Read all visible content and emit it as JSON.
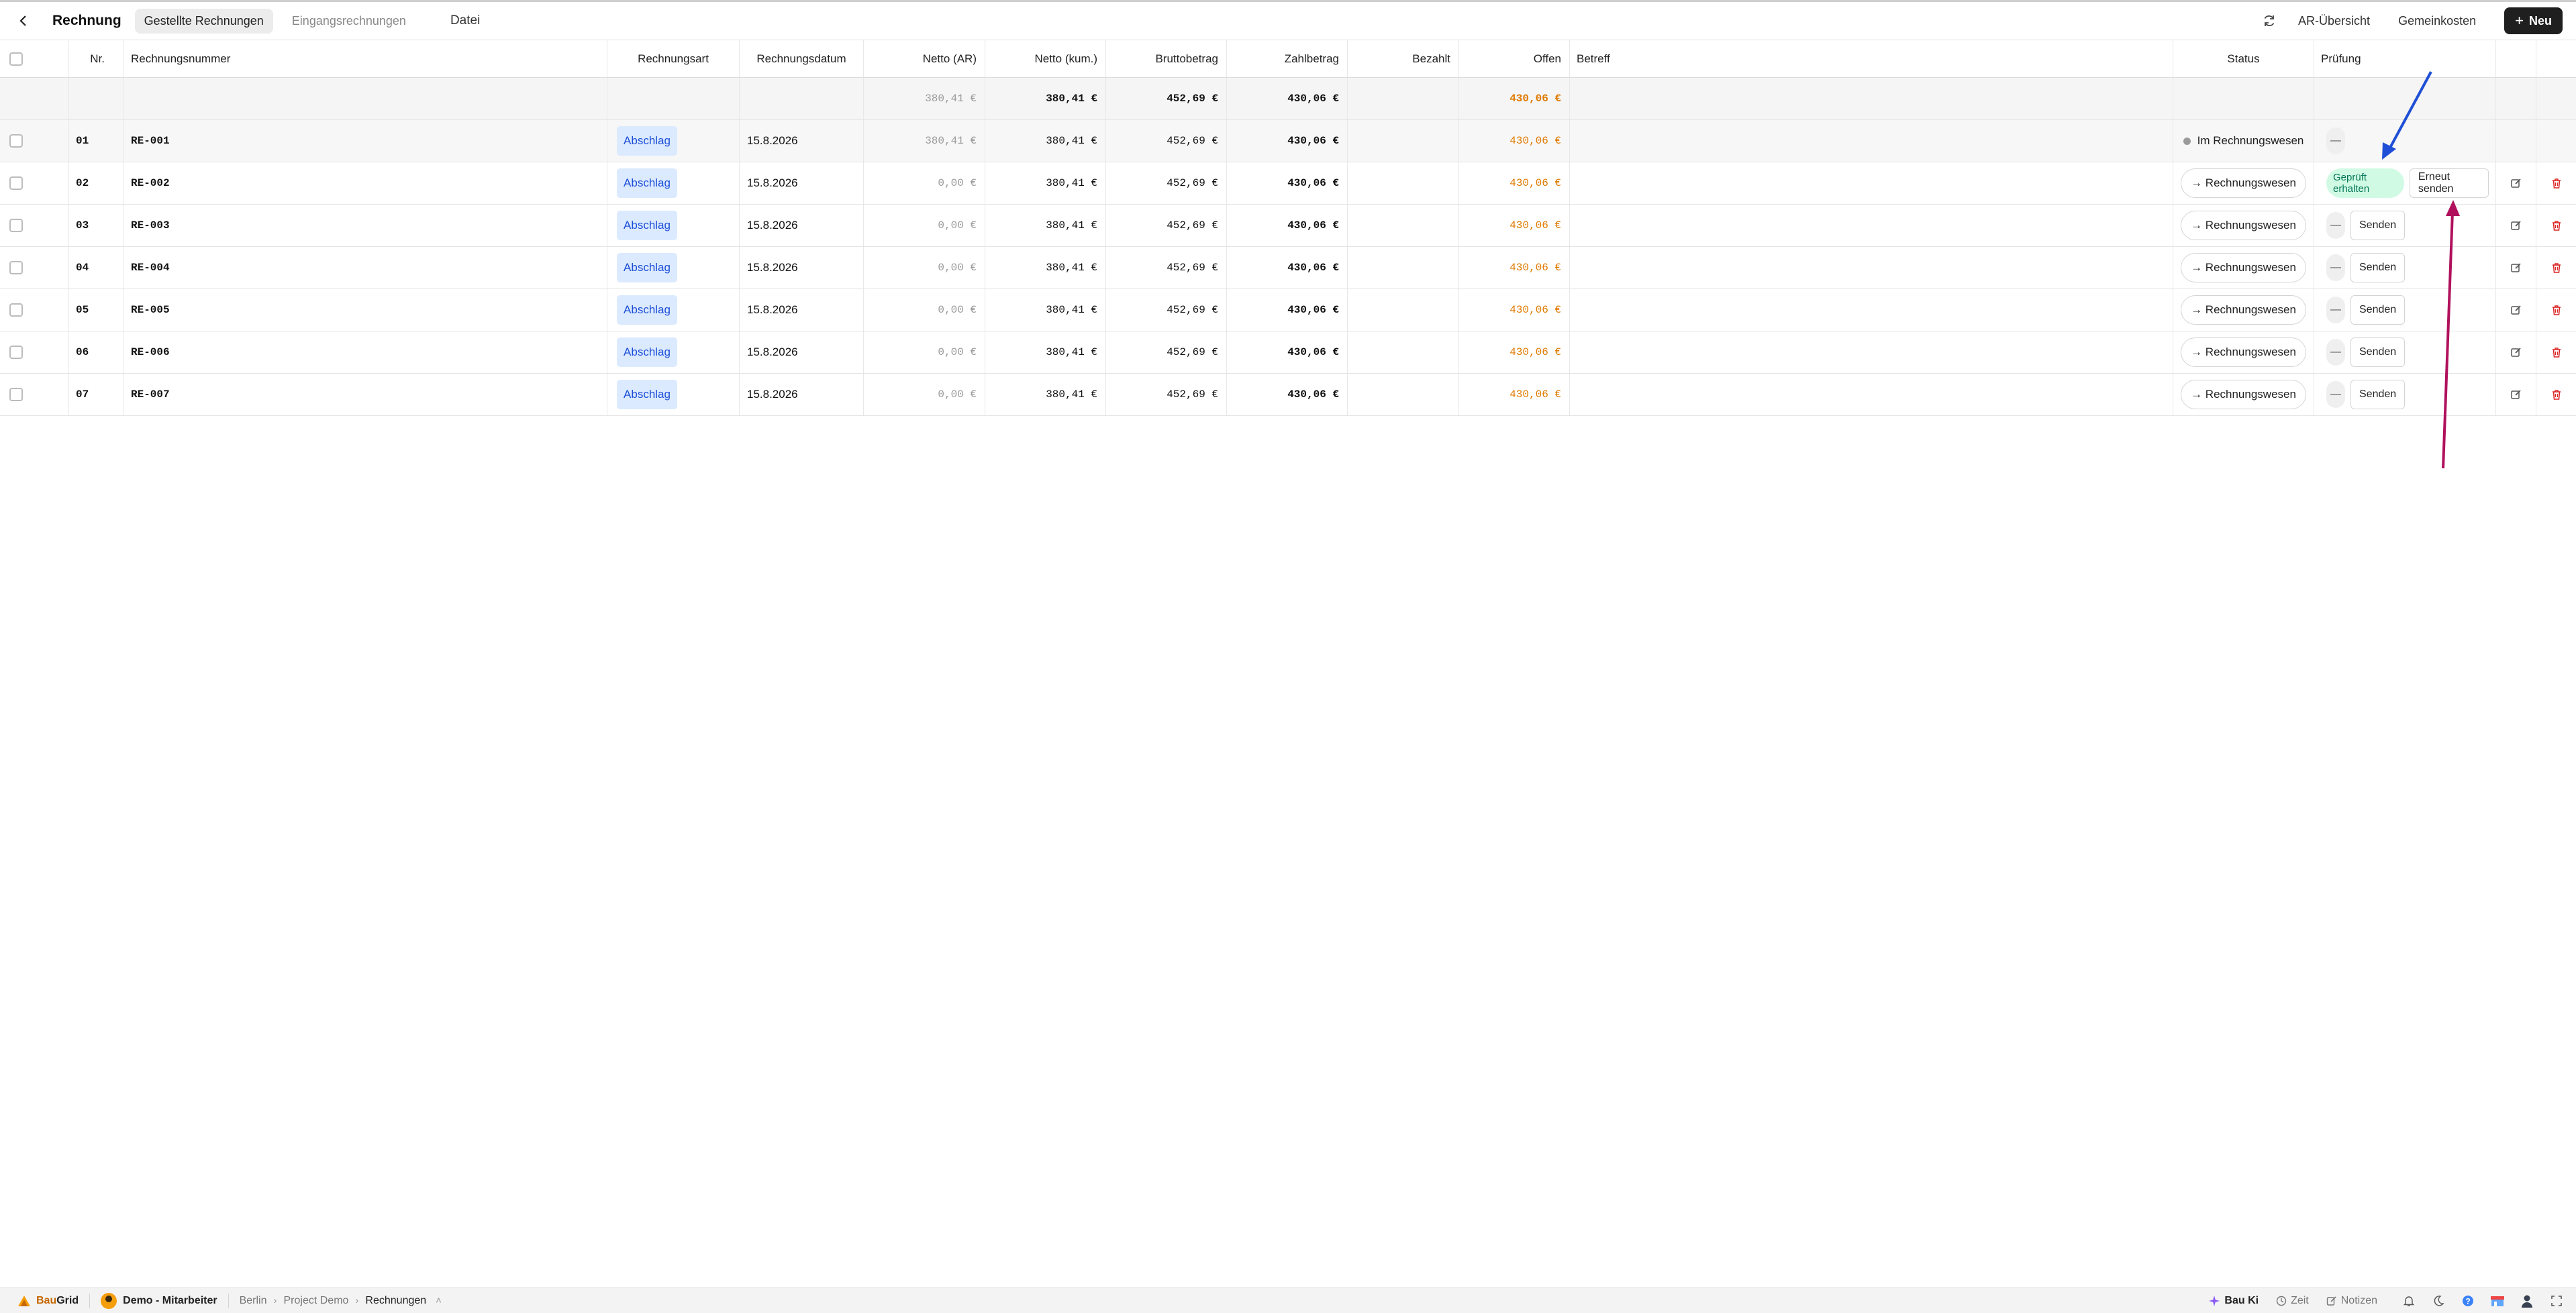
{
  "header": {
    "title": "Rechnung",
    "tabs": [
      "Gestellte Rechnungen",
      "Eingangsrechnungen",
      "Datei"
    ],
    "links": [
      "AR-Übersicht",
      "Gemeinkosten"
    ],
    "new_button": "Neu"
  },
  "columns": {
    "nr": "Nr.",
    "rechnungsnummer": "Rechnungsnummer",
    "rechnungsart": "Rechnungsart",
    "rechnungsdatum": "Rechnungsdatum",
    "netto_ar": "Netto (AR)",
    "netto_kum": "Netto (kum.)",
    "brutto": "Bruttobetrag",
    "zahlbetrag": "Zahlbetrag",
    "bezahlt": "Bezahlt",
    "offen": "Offen",
    "betreff": "Betreff",
    "status": "Status",
    "pruefung": "Prüfung"
  },
  "summary": {
    "netto_ar": "380,41 €",
    "netto_kum": "380,41 €",
    "brutto": "452,69 €",
    "zahlbetrag": "430,06 €",
    "offen": "430,06 €"
  },
  "rows": [
    {
      "nr": "01",
      "number": "RE-001",
      "art": "Abschlag",
      "date": "15.8.2026",
      "netto_ar": "380,41 €",
      "netto_kum": "380,41 €",
      "brutto": "452,69 €",
      "zahlbetrag": "430,06 €",
      "offen": "430,06 €",
      "status": "Im Rechnungswesen",
      "pruefung": "—"
    },
    {
      "nr": "02",
      "number": "RE-002",
      "art": "Abschlag",
      "date": "15.8.2026",
      "netto_ar": "0,00 €",
      "netto_kum": "380,41 €",
      "brutto": "452,69 €",
      "zahlbetrag": "430,06 €",
      "offen": "430,06 €",
      "status": "→ Rechnungswesen",
      "pruefung_badge": "Geprüft erhalten",
      "pruefung_action": "Erneut senden"
    },
    {
      "nr": "03",
      "number": "RE-003",
      "art": "Abschlag",
      "date": "15.8.2026",
      "netto_ar": "0,00 €",
      "netto_kum": "380,41 €",
      "brutto": "452,69 €",
      "zahlbetrag": "430,06 €",
      "offen": "430,06 €",
      "status": "→ Rechnungswesen",
      "pruefung": "—",
      "pruefung_action": "Senden"
    },
    {
      "nr": "04",
      "number": "RE-004",
      "art": "Abschlag",
      "date": "15.8.2026",
      "netto_ar": "0,00 €",
      "netto_kum": "380,41 €",
      "brutto": "452,69 €",
      "zahlbetrag": "430,06 €",
      "offen": "430,06 €",
      "status": "→ Rechnungswesen",
      "pruefung": "—",
      "pruefung_action": "Senden"
    },
    {
      "nr": "05",
      "number": "RE-005",
      "art": "Abschlag",
      "date": "15.8.2026",
      "netto_ar": "0,00 €",
      "netto_kum": "380,41 €",
      "brutto": "452,69 €",
      "zahlbetrag": "430,06 €",
      "offen": "430,06 €",
      "status": "→ Rechnungswesen",
      "pruefung": "—",
      "pruefung_action": "Senden"
    },
    {
      "nr": "06",
      "number": "RE-006",
      "art": "Abschlag",
      "date": "15.8.2026",
      "netto_ar": "0,00 €",
      "netto_kum": "380,41 €",
      "brutto": "452,69 €",
      "zahlbetrag": "430,06 €",
      "offen": "430,06 €",
      "status": "→ Rechnungswesen",
      "pruefung": "—",
      "pruefung_action": "Senden"
    },
    {
      "nr": "07",
      "number": "RE-007",
      "art": "Abschlag",
      "date": "15.8.2026",
      "netto_ar": "0,00 €",
      "netto_kum": "380,41 €",
      "brutto": "452,69 €",
      "zahlbetrag": "430,06 €",
      "offen": "430,06 €",
      "status": "→ Rechnungswesen",
      "pruefung": "—",
      "pruefung_action": "Senden"
    }
  ],
  "annotations": {
    "arrow_blue_color": "#1f4fd6",
    "arrow_pink_color": "#b0105c"
  },
  "footer": {
    "brand_a": "Bau",
    "brand_b": "Grid",
    "user": "Demo - Mitarbeiter",
    "breadcrumb": [
      "Berlin",
      "Project Demo",
      "Rechnungen"
    ],
    "bau_ki": "Bau Ki",
    "zeit": "Zeit",
    "notizen": "Notizen"
  },
  "colors": {
    "accent_orange": "#e07a00",
    "badge_blue_bg": "#dbeafe",
    "badge_green_bg": "#d1fae5",
    "delete_red": "#dc2626"
  }
}
